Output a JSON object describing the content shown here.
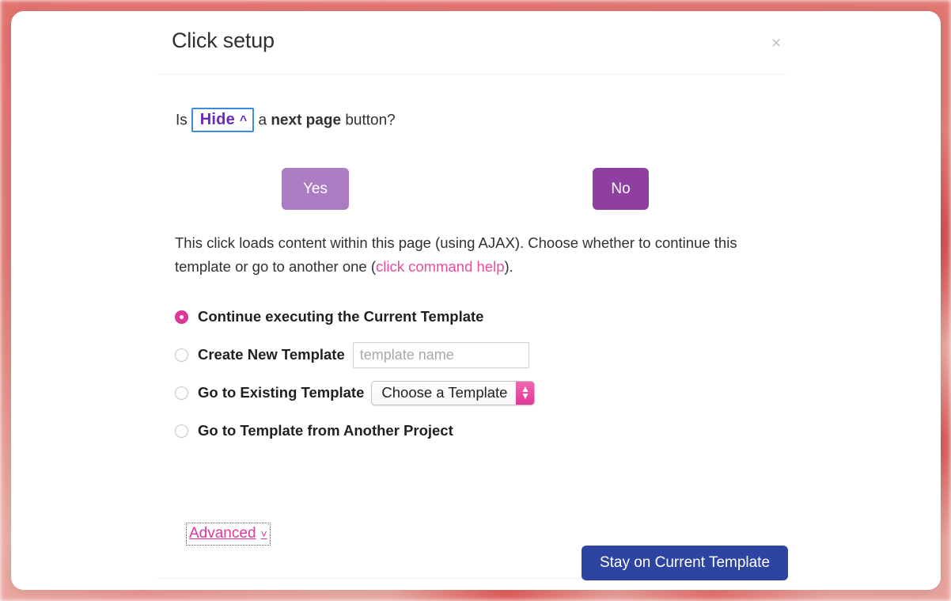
{
  "dialog": {
    "title": "Click setup",
    "close_icon": "close-icon"
  },
  "question": {
    "lead": "Is",
    "chip_label": "Hide",
    "chip_icon": "chevron-up-icon",
    "middle": "a",
    "emphasis": "next page",
    "tail": "button?"
  },
  "answer_buttons": {
    "yes_label": "Yes",
    "no_label": "No"
  },
  "description": {
    "part1": "This click loads content within this page (using AJAX). Choose whether to continue this template or go to another one (",
    "link_text": "click command help",
    "part2": ")."
  },
  "options": [
    {
      "label": "Continue executing the Current Template",
      "selected": true
    },
    {
      "label": "Create New Template",
      "selected": false,
      "input_placeholder": "template name",
      "input_value": ""
    },
    {
      "label": "Go to Existing Template",
      "selected": false,
      "select_value": "Choose a Template"
    },
    {
      "label": "Go to Template from Another Project",
      "selected": false
    }
  ],
  "advanced": {
    "label": "Advanced",
    "icon": "chevron-down-icon"
  },
  "footer": {
    "primary_label": "Stay on Current Template"
  },
  "colors": {
    "accent_pink": "#e0369a",
    "purple_dark": "#8f3f9f",
    "purple_light": "#ac7cc2",
    "chip_purple": "#6c28bd",
    "chip_border_blue": "#3b8ce0",
    "primary_blue": "#2e44a3",
    "backdrop_red": "#e2736f"
  }
}
